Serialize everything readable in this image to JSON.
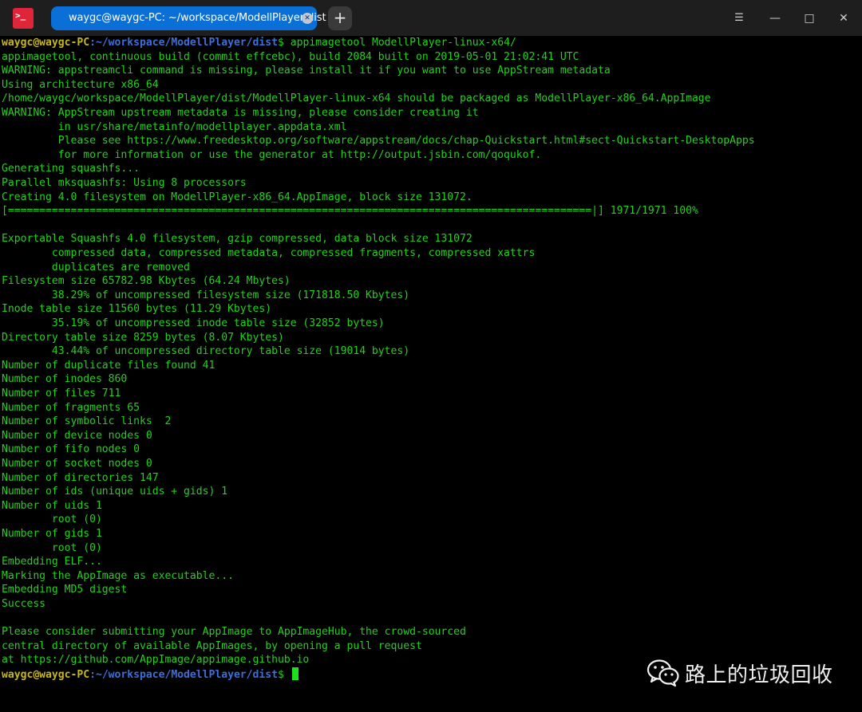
{
  "titlebar": {
    "tab_title": "waygc@waygc-PC: ~/workspace/ModellPlayer/dist",
    "tab_close_glyph": "✕",
    "new_tab_glyph": "+",
    "menu_glyph": "☰",
    "minimize_glyph": "—",
    "maximize_glyph": "□",
    "close_glyph": "✕",
    "app_icon_glyph": ">_"
  },
  "terminal": {
    "prompt_user": "waygc@waygc-PC",
    "prompt_path": ":~/workspace/ModellPlayer/dist",
    "prompt_symbol": "$ ",
    "command": "appimagetool ModellPlayer-linux-x64/",
    "lines": [
      "appimagetool, continuous build (commit effcebc), build 2084 built on 2019-05-01 21:02:41 UTC",
      "WARNING: appstreamcli command is missing, please install it if you want to use AppStream metadata",
      "Using architecture x86_64",
      "/home/waygc/workspace/ModellPlayer/dist/ModellPlayer-linux-x64 should be packaged as ModellPlayer-x86_64.AppImage",
      "WARNING: AppStream upstream metadata is missing, please consider creating it",
      "         in usr/share/metainfo/modellplayer.appdata.xml",
      "         Please see https://www.freedesktop.org/software/appstream/docs/chap-Quickstart.html#sect-Quickstart-DesktopApps",
      "         for more information or use the generator at http://output.jsbin.com/qoqukof.",
      "Generating squashfs...",
      "Parallel mksquashfs: Using 8 processors",
      "Creating 4.0 filesystem on ModellPlayer-x86_64.AppImage, block size 131072.",
      "[=============================================================================================|] 1971/1971 100%",
      "",
      "Exportable Squashfs 4.0 filesystem, gzip compressed, data block size 131072",
      "        compressed data, compressed metadata, compressed fragments, compressed xattrs",
      "        duplicates are removed",
      "Filesystem size 65782.98 Kbytes (64.24 Mbytes)",
      "        38.29% of uncompressed filesystem size (171818.50 Kbytes)",
      "Inode table size 11560 bytes (11.29 Kbytes)",
      "        35.19% of uncompressed inode table size (32852 bytes)",
      "Directory table size 8259 bytes (8.07 Kbytes)",
      "        43.44% of uncompressed directory table size (19014 bytes)",
      "Number of duplicate files found 41",
      "Number of inodes 860",
      "Number of files 711",
      "Number of fragments 65",
      "Number of symbolic links  2",
      "Number of device nodes 0",
      "Number of fifo nodes 0",
      "Number of socket nodes 0",
      "Number of directories 147",
      "Number of ids (unique uids + gids) 1",
      "Number of uids 1",
      "        root (0)",
      "Number of gids 1",
      "        root (0)",
      "Embedding ELF...",
      "Marking the AppImage as executable...",
      "Embedding MD5 digest",
      "Success",
      "",
      "Please consider submitting your AppImage to AppImageHub, the crowd-sourced",
      "central directory of available AppImages, by opening a pull request",
      "at https://github.com/AppImage/appimage.github.io"
    ]
  },
  "watermark": {
    "text": "路上的垃圾回收",
    "icon": "wechat-icon"
  },
  "colors": {
    "output": "#23d11c",
    "prompt_user": "#c6b71a",
    "prompt_path": "#3d6fd8",
    "tab_active": "#0a6fd6",
    "app_icon": "#e0243a"
  }
}
